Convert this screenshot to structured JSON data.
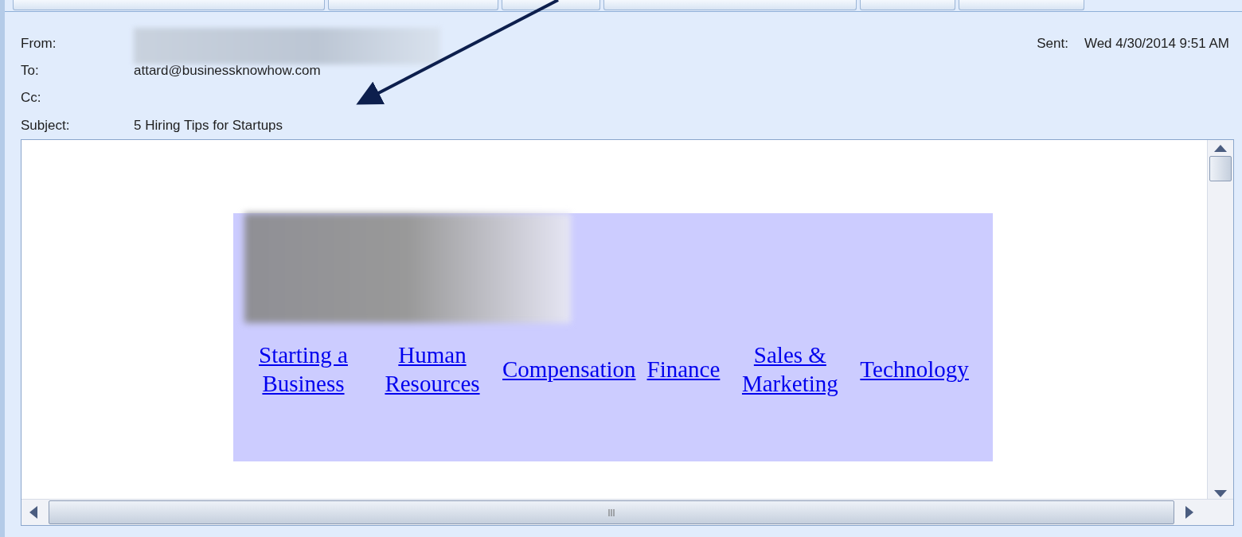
{
  "header": {
    "fields": [
      {
        "label": "From:",
        "kind": "redacted"
      },
      {
        "label": "To:",
        "kind": "text",
        "value": "attard@businessknowhow.com"
      },
      {
        "label": "Cc:",
        "kind": "empty"
      },
      {
        "label": "Subject:",
        "kind": "text",
        "value": "5 Hiring Tips for Startups"
      }
    ],
    "sent": {
      "label": "Sent:",
      "value": "Wed 4/30/2014 9:51 AM"
    }
  },
  "banner": {
    "logo": {
      "redacted": true
    },
    "nav_links": [
      "Starting a Business",
      "Human Resources",
      "Compensation",
      "Finance",
      "Sales & Marketing",
      "Technology"
    ]
  }
}
